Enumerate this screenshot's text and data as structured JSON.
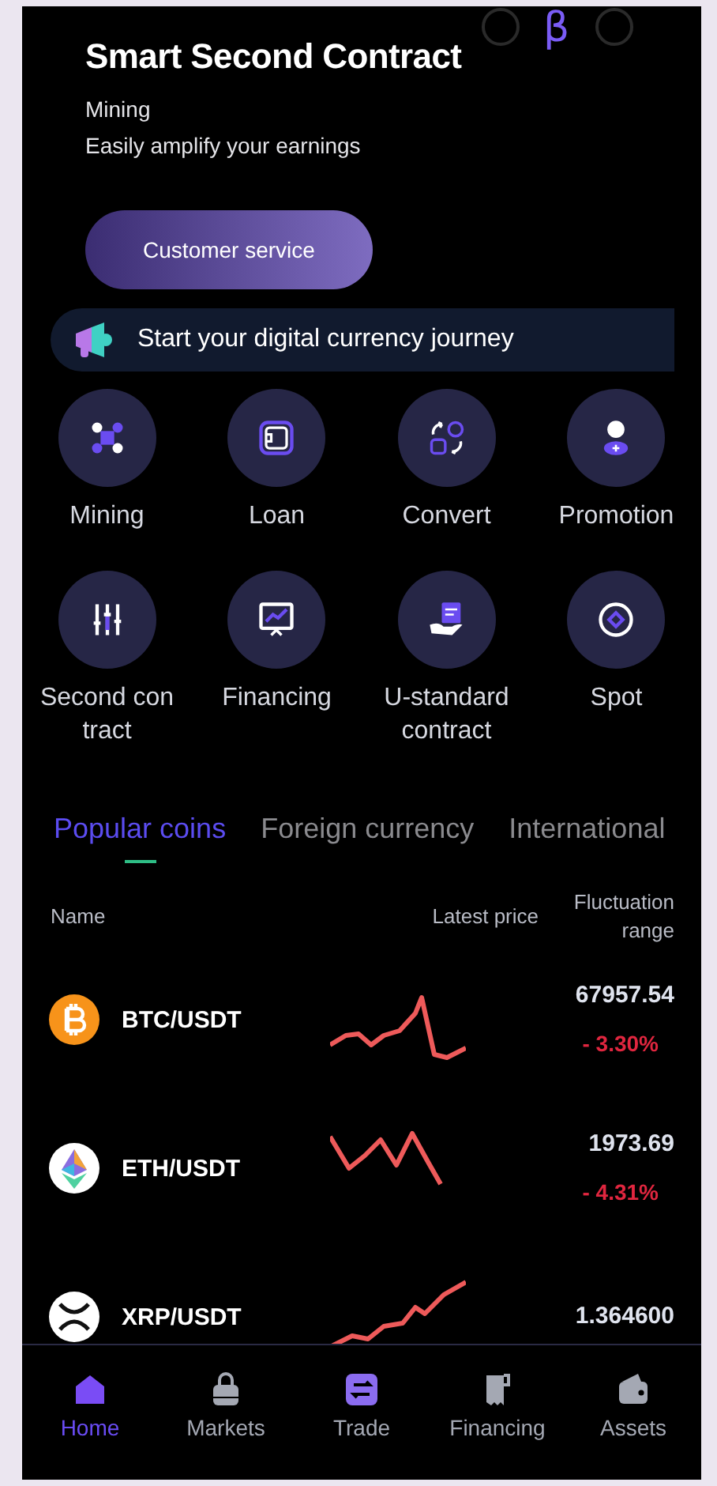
{
  "header": {
    "badge": "β",
    "title": "Smart Second Contract",
    "subtitle": "Mining",
    "tagline": "Easily amplify your earnings",
    "button": "Customer service"
  },
  "notice": {
    "text": "Start your digital currency journey"
  },
  "shortcuts": [
    {
      "label": "Mining"
    },
    {
      "label": "Loan"
    },
    {
      "label": "Convert"
    },
    {
      "label": "Promotion"
    },
    {
      "label": "Second con tract"
    },
    {
      "label": "Financing"
    },
    {
      "label": "U-standard contract"
    },
    {
      "label": "Spot"
    }
  ],
  "market_tabs": [
    {
      "label": "Popular coins",
      "selected": true
    },
    {
      "label": "Foreign currency",
      "selected": false
    },
    {
      "label": "International",
      "selected": false
    }
  ],
  "table": {
    "columns": [
      "Name",
      "Latest price",
      "Fluctuation range"
    ],
    "rows": [
      {
        "pair": "BTC/USDT",
        "price": "67957.54",
        "change": "- 3.30%"
      },
      {
        "pair": "ETH/USDT",
        "price": "1973.69",
        "change": "- 4.31%"
      },
      {
        "pair": "XRP/USDT",
        "price": "1.364600"
      }
    ]
  },
  "bottom_nav": [
    {
      "label": "Home",
      "selected": true
    },
    {
      "label": "Markets",
      "selected": false
    },
    {
      "label": "Trade",
      "selected": false
    },
    {
      "label": "Financing",
      "selected": false
    },
    {
      "label": "Assets",
      "selected": false
    }
  ]
}
